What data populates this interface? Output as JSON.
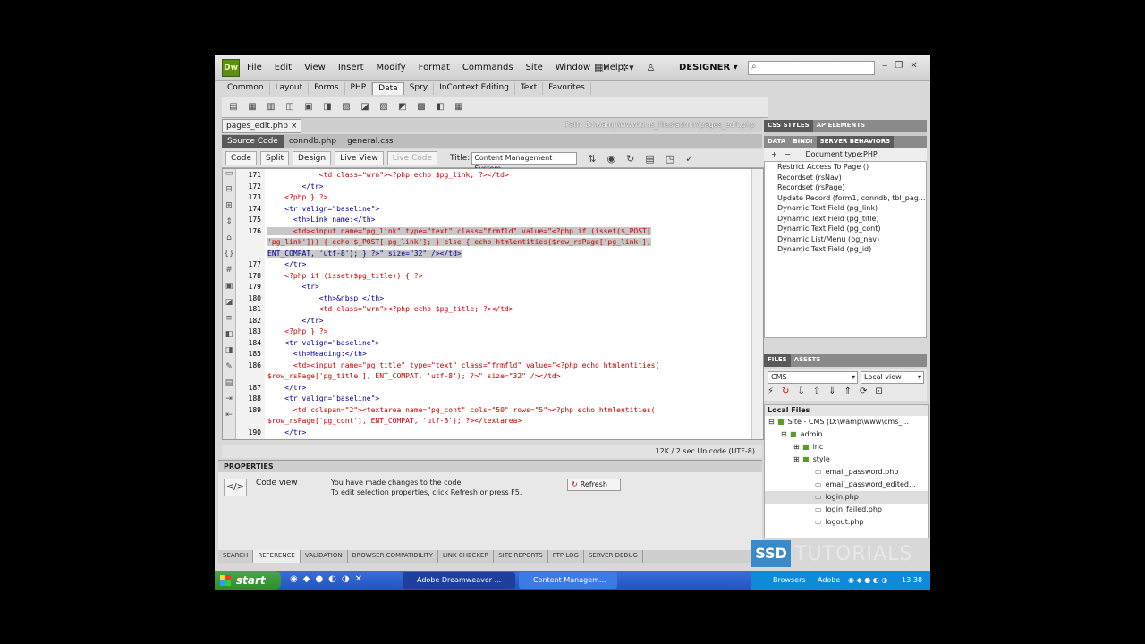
{
  "app": {
    "logo": "Dw",
    "menu": [
      "File",
      "Edit",
      "View",
      "Insert",
      "Modify",
      "Format",
      "Commands",
      "Site",
      "Window",
      "Help"
    ],
    "workspace": "DESIGNER",
    "search_placeholder": ""
  },
  "insert_tabs": [
    "Common",
    "Layout",
    "Forms",
    "PHP",
    "Data",
    "Spry",
    "InContext Editing",
    "Text",
    "Favorites"
  ],
  "active_insert_tab": "Data",
  "document": {
    "tab": "pages_edit.php",
    "close": "×",
    "path": "Path: D:\\wamp\\www\\cms_files\\admin\\pages_edit.php",
    "related": [
      "Source Code",
      "conndb.php",
      "general.css"
    ],
    "view_buttons": [
      "Code",
      "Split",
      "Design",
      "Live View",
      "Live Code"
    ],
    "title_label": "Title:",
    "title_value": "Content Management System"
  },
  "code": {
    "lines": [
      {
        "num": "171",
        "text": "            <td class=\"wrn\"><?php echo $pg_link; ?></td>"
      },
      {
        "num": "172",
        "text": "        </tr>"
      },
      {
        "num": "173",
        "text": "    <?php } ?>"
      },
      {
        "num": "174",
        "text": "    <tr valign=\"baseline\">"
      },
      {
        "num": "175",
        "text": "      <th>Link name:</th>"
      },
      {
        "num": "176",
        "text": "      <td><input name=\"pg_link\" type=\"text\" class=\"frmfld\" value=\"<?php if (isset($_POST["
      },
      {
        "num": "",
        "text": "'pg_link'])) { echo $_POST['pg_link']; } else { echo htmlentities($row_rsPage['pg_link'],"
      },
      {
        "num": "",
        "text": "ENT_COMPAT, 'utf-8'); } ?>\" size=\"32\" /></td>"
      },
      {
        "num": "177",
        "text": "    </tr>"
      },
      {
        "num": "178",
        "text": "    <?php if (isset($pg_title)) { ?>"
      },
      {
        "num": "179",
        "text": "        <tr>"
      },
      {
        "num": "180",
        "text": "            <th>&nbsp;</th>"
      },
      {
        "num": "181",
        "text": "            <td class=\"wrn\"><?php echo $pg_title; ?></td>"
      },
      {
        "num": "182",
        "text": "        </tr>"
      },
      {
        "num": "183",
        "text": "    <?php } ?>"
      },
      {
        "num": "184",
        "text": "    <tr valign=\"baseline\">"
      },
      {
        "num": "185",
        "text": "      <th>Heading:</th>"
      },
      {
        "num": "186",
        "text": "      <td><input name=\"pg_title\" type=\"text\" class=\"frmfld\" value=\"<?php echo htmlentities("
      },
      {
        "num": "",
        "text": "$row_rsPage['pg_title'], ENT_COMPAT, 'utf-8'); ?>\" size=\"32\" /></td>"
      },
      {
        "num": "187",
        "text": "    </tr>"
      },
      {
        "num": "188",
        "text": "    <tr valign=\"baseline\">"
      },
      {
        "num": "189",
        "text": "      <td colspan=\"2\"><textarea name=\"pg_cont\" cols=\"50\" rows=\"5\"><?php echo htmlentities("
      },
      {
        "num": "",
        "text": "$row_rsPage['pg_cont'], ENT_COMPAT, 'utf-8'); ?></textarea>"
      },
      {
        "num": "190",
        "text": "    </tr>"
      }
    ]
  },
  "status": "12K / 2 sec  Unicode (UTF-8)",
  "properties": {
    "title": "PROPERTIES",
    "mode": "Code view",
    "msg1": "You have made changes to the code.",
    "msg2": "To edit selection properties, click Refresh or press F5.",
    "refresh": "Refresh"
  },
  "bottom_tabs": [
    "SEARCH",
    "REFERENCE",
    "VALIDATION",
    "BROWSER COMPATIBILITY",
    "LINK CHECKER",
    "SITE REPORTS",
    "FTP LOG",
    "SERVER DEBUG"
  ],
  "active_bottom_tab": "REFERENCE",
  "panels": {
    "top_tabs": [
      "CSS STYLES",
      "AP ELEMENTS"
    ],
    "server_tabs": [
      "DATA",
      "BINDI",
      "SERVER BEHAVIORS"
    ],
    "doc_type": "Document type:PHP",
    "behaviors": [
      "Restrict Access To Page ()",
      "Recordset (rsNav)",
      "Recordset (rsPage)",
      "Update Record (form1, conndb, tbl_pag...",
      "Dynamic Text Field (pg_link)",
      "Dynamic Text Field (pg_title)",
      "Dynamic Text Field (pg_cont)",
      "Dynamic List/Menu (pg_nav)",
      "Dynamic Text Field (pg_id)"
    ],
    "files_tabs": [
      "FILES",
      "ASSETS"
    ],
    "site": "CMS",
    "view": "Local view",
    "local_files": "Local Files",
    "tree": [
      {
        "label": "Site - CMS (D:\\wamp\\www\\cms_...",
        "indent": 0,
        "type": "site",
        "exp": "⊟"
      },
      {
        "label": "admin",
        "indent": 1,
        "type": "folder",
        "exp": "⊟"
      },
      {
        "label": "inc",
        "indent": 2,
        "type": "folder",
        "exp": "⊞"
      },
      {
        "label": "style",
        "indent": 2,
        "type": "folder",
        "exp": "⊞"
      },
      {
        "label": "email_password.php",
        "indent": 3,
        "type": "file",
        "exp": ""
      },
      {
        "label": "email_password_edited...",
        "indent": 3,
        "type": "file",
        "exp": ""
      },
      {
        "label": "login.php",
        "indent": 3,
        "type": "file",
        "exp": "",
        "selected": true
      },
      {
        "label": "login_failed.php",
        "indent": 3,
        "type": "file",
        "exp": ""
      },
      {
        "label": "logout.php",
        "indent": 3,
        "type": "file",
        "exp": ""
      }
    ]
  },
  "taskbar": {
    "start": "start",
    "tasks": [
      "Adobe Dreamweaver ...",
      "Content Managem..."
    ],
    "tray": [
      "Browsers",
      "Adobe"
    ],
    "clock": "13:38"
  },
  "watermark": {
    "box": "SSD",
    "text": "TUTORIALS"
  },
  "colors": {
    "tag": "#000099",
    "php": "#cc0000",
    "string": "#0000ff",
    "attr": "#000099",
    "highlight": "#c8c8c8"
  }
}
